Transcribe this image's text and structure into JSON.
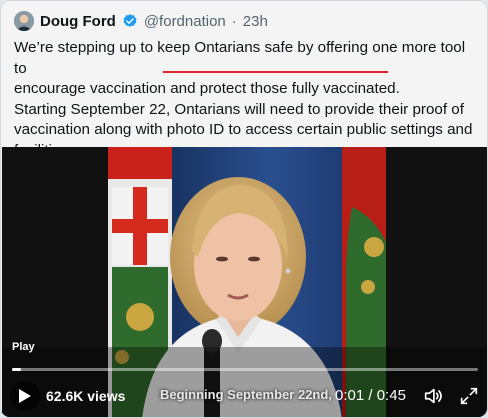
{
  "tweet": {
    "author": "Doug Ford",
    "handle": "@fordnation",
    "separator": "·",
    "time": "23h",
    "text_line1": "We’re stepping up to keep Ontarians safe by offering one more tool to",
    "text_line2a": "encourage vaccination ",
    "text_line2b": "and protect those fully vaccinated.",
    "text_line3": "Starting September 22, Ontarians will need to provide their proof of",
    "text_line4": "vaccination along with photo ID to access certain public settings and",
    "text_line5": "facilities"
  },
  "video": {
    "play_label": "Play",
    "views": "62.6K views",
    "caption": "Beginning September 22nd,",
    "time_current": "0:01",
    "time_separator": " / ",
    "time_total": "0:45",
    "progress_fraction": 0.02
  },
  "colors": {
    "accent_underline": "#e0262c",
    "verified_badge": "#1d9bf0",
    "flag_red": "#d52b1e",
    "flag_green": "#2e6b2c"
  },
  "icons": {
    "verified": "verified-badge-icon",
    "play": "play-icon",
    "volume": "volume-icon",
    "fullscreen": "fullscreen-icon"
  }
}
